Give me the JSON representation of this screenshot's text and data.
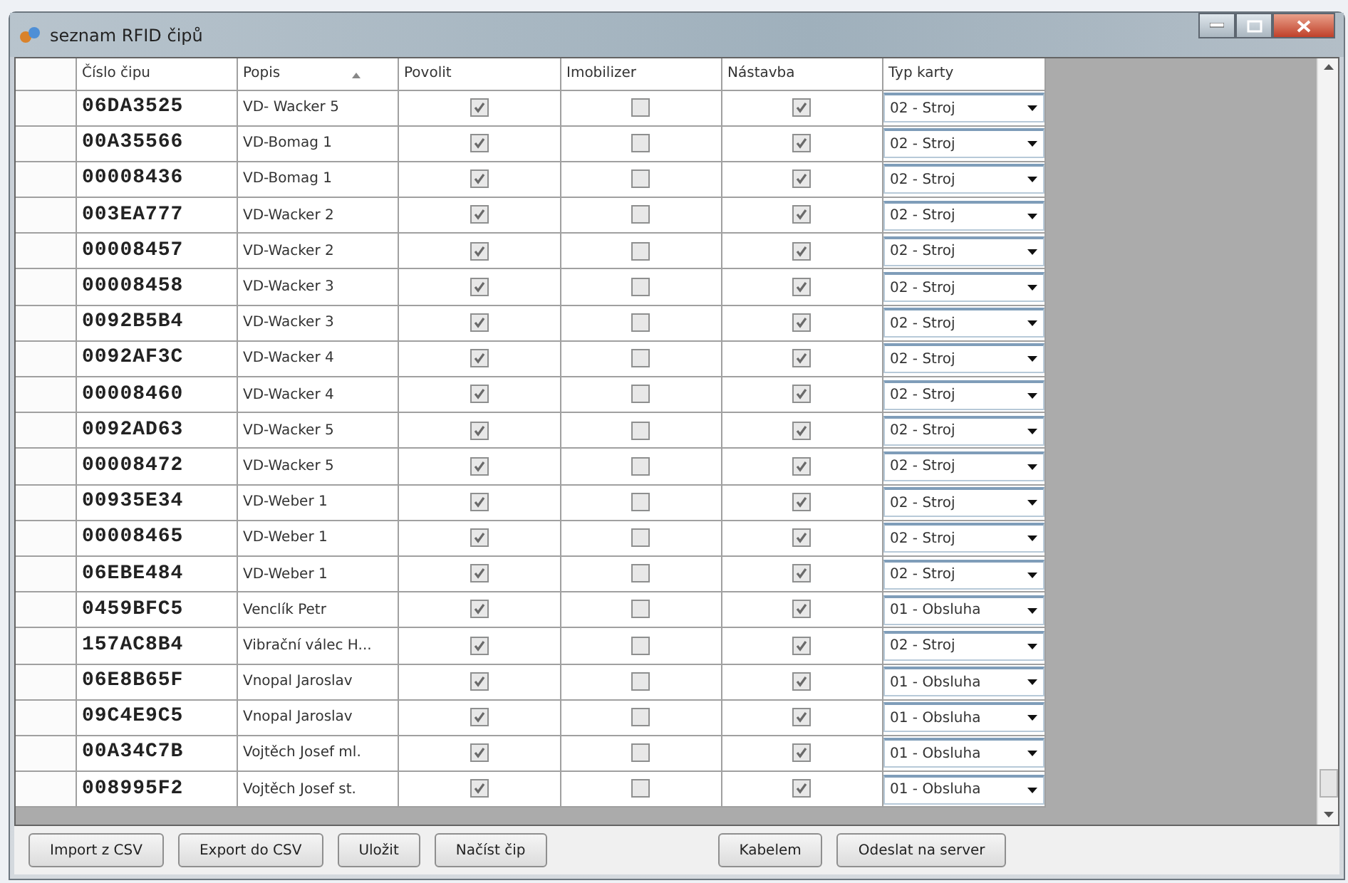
{
  "window": {
    "title": "seznam RFID čipů"
  },
  "table": {
    "columns": [
      {
        "label": "Číslo čipu",
        "sorted": false
      },
      {
        "label": "Popis",
        "sorted": true
      },
      {
        "label": "Povolit",
        "sorted": false
      },
      {
        "label": "Imobilizer",
        "sorted": false
      },
      {
        "label": "Nástavba",
        "sorted": false
      },
      {
        "label": "Typ karty",
        "sorted": false
      }
    ],
    "rows": [
      {
        "chip": "06DA3525",
        "popis": "VD- Wacker 5",
        "povolit": true,
        "imobilizer": false,
        "nastavba": true,
        "typ": "02 - Stroj"
      },
      {
        "chip": "00A35566",
        "popis": "VD-Bomag 1",
        "povolit": true,
        "imobilizer": false,
        "nastavba": true,
        "typ": "02 - Stroj"
      },
      {
        "chip": "00008436",
        "popis": "VD-Bomag 1",
        "povolit": true,
        "imobilizer": false,
        "nastavba": true,
        "typ": "02 - Stroj"
      },
      {
        "chip": "003EA777",
        "popis": "VD-Wacker 2",
        "povolit": true,
        "imobilizer": false,
        "nastavba": true,
        "typ": "02 - Stroj"
      },
      {
        "chip": "00008457",
        "popis": "VD-Wacker 2",
        "povolit": true,
        "imobilizer": false,
        "nastavba": true,
        "typ": "02 - Stroj"
      },
      {
        "chip": "00008458",
        "popis": "VD-Wacker 3",
        "povolit": true,
        "imobilizer": false,
        "nastavba": true,
        "typ": "02 - Stroj"
      },
      {
        "chip": "0092B5B4",
        "popis": "VD-Wacker 3",
        "povolit": true,
        "imobilizer": false,
        "nastavba": true,
        "typ": "02 - Stroj"
      },
      {
        "chip": "0092AF3C",
        "popis": "VD-Wacker 4",
        "povolit": true,
        "imobilizer": false,
        "nastavba": true,
        "typ": "02 - Stroj"
      },
      {
        "chip": "00008460",
        "popis": "VD-Wacker 4",
        "povolit": true,
        "imobilizer": false,
        "nastavba": true,
        "typ": "02 - Stroj"
      },
      {
        "chip": "0092AD63",
        "popis": "VD-Wacker 5",
        "povolit": true,
        "imobilizer": false,
        "nastavba": true,
        "typ": "02 - Stroj"
      },
      {
        "chip": "00008472",
        "popis": "VD-Wacker 5",
        "povolit": true,
        "imobilizer": false,
        "nastavba": true,
        "typ": "02 - Stroj"
      },
      {
        "chip": "00935E34",
        "popis": "VD-Weber 1",
        "povolit": true,
        "imobilizer": false,
        "nastavba": true,
        "typ": "02 - Stroj"
      },
      {
        "chip": "00008465",
        "popis": "VD-Weber 1",
        "povolit": true,
        "imobilizer": false,
        "nastavba": true,
        "typ": "02 - Stroj"
      },
      {
        "chip": "06EBE484",
        "popis": "VD-Weber 1",
        "povolit": true,
        "imobilizer": false,
        "nastavba": true,
        "typ": "02 - Stroj"
      },
      {
        "chip": "0459BFC5",
        "popis": "Venclík Petr",
        "povolit": true,
        "imobilizer": false,
        "nastavba": true,
        "typ": "01 - Obsluha"
      },
      {
        "chip": "157AC8B4",
        "popis": "Vibrační válec H...",
        "povolit": true,
        "imobilizer": false,
        "nastavba": true,
        "typ": "02 - Stroj"
      },
      {
        "chip": "06E8B65F",
        "popis": "Vnopal Jaroslav",
        "povolit": true,
        "imobilizer": false,
        "nastavba": true,
        "typ": "01 - Obsluha"
      },
      {
        "chip": "09C4E9C5",
        "popis": "Vnopal Jaroslav",
        "povolit": true,
        "imobilizer": false,
        "nastavba": true,
        "typ": "01 - Obsluha"
      },
      {
        "chip": "00A34C7B",
        "popis": "Vojtěch Josef ml.",
        "povolit": true,
        "imobilizer": false,
        "nastavba": true,
        "typ": "01 - Obsluha"
      },
      {
        "chip": "008995F2",
        "popis": "Vojtěch Josef st.",
        "povolit": true,
        "imobilizer": false,
        "nastavba": true,
        "typ": "01 - Obsluha"
      }
    ]
  },
  "buttons_left": [
    "Import z CSV",
    "Export do CSV",
    "Uložit",
    "Načíst čip"
  ],
  "buttons_right": [
    "Kabelem",
    "Odeslat na server"
  ]
}
